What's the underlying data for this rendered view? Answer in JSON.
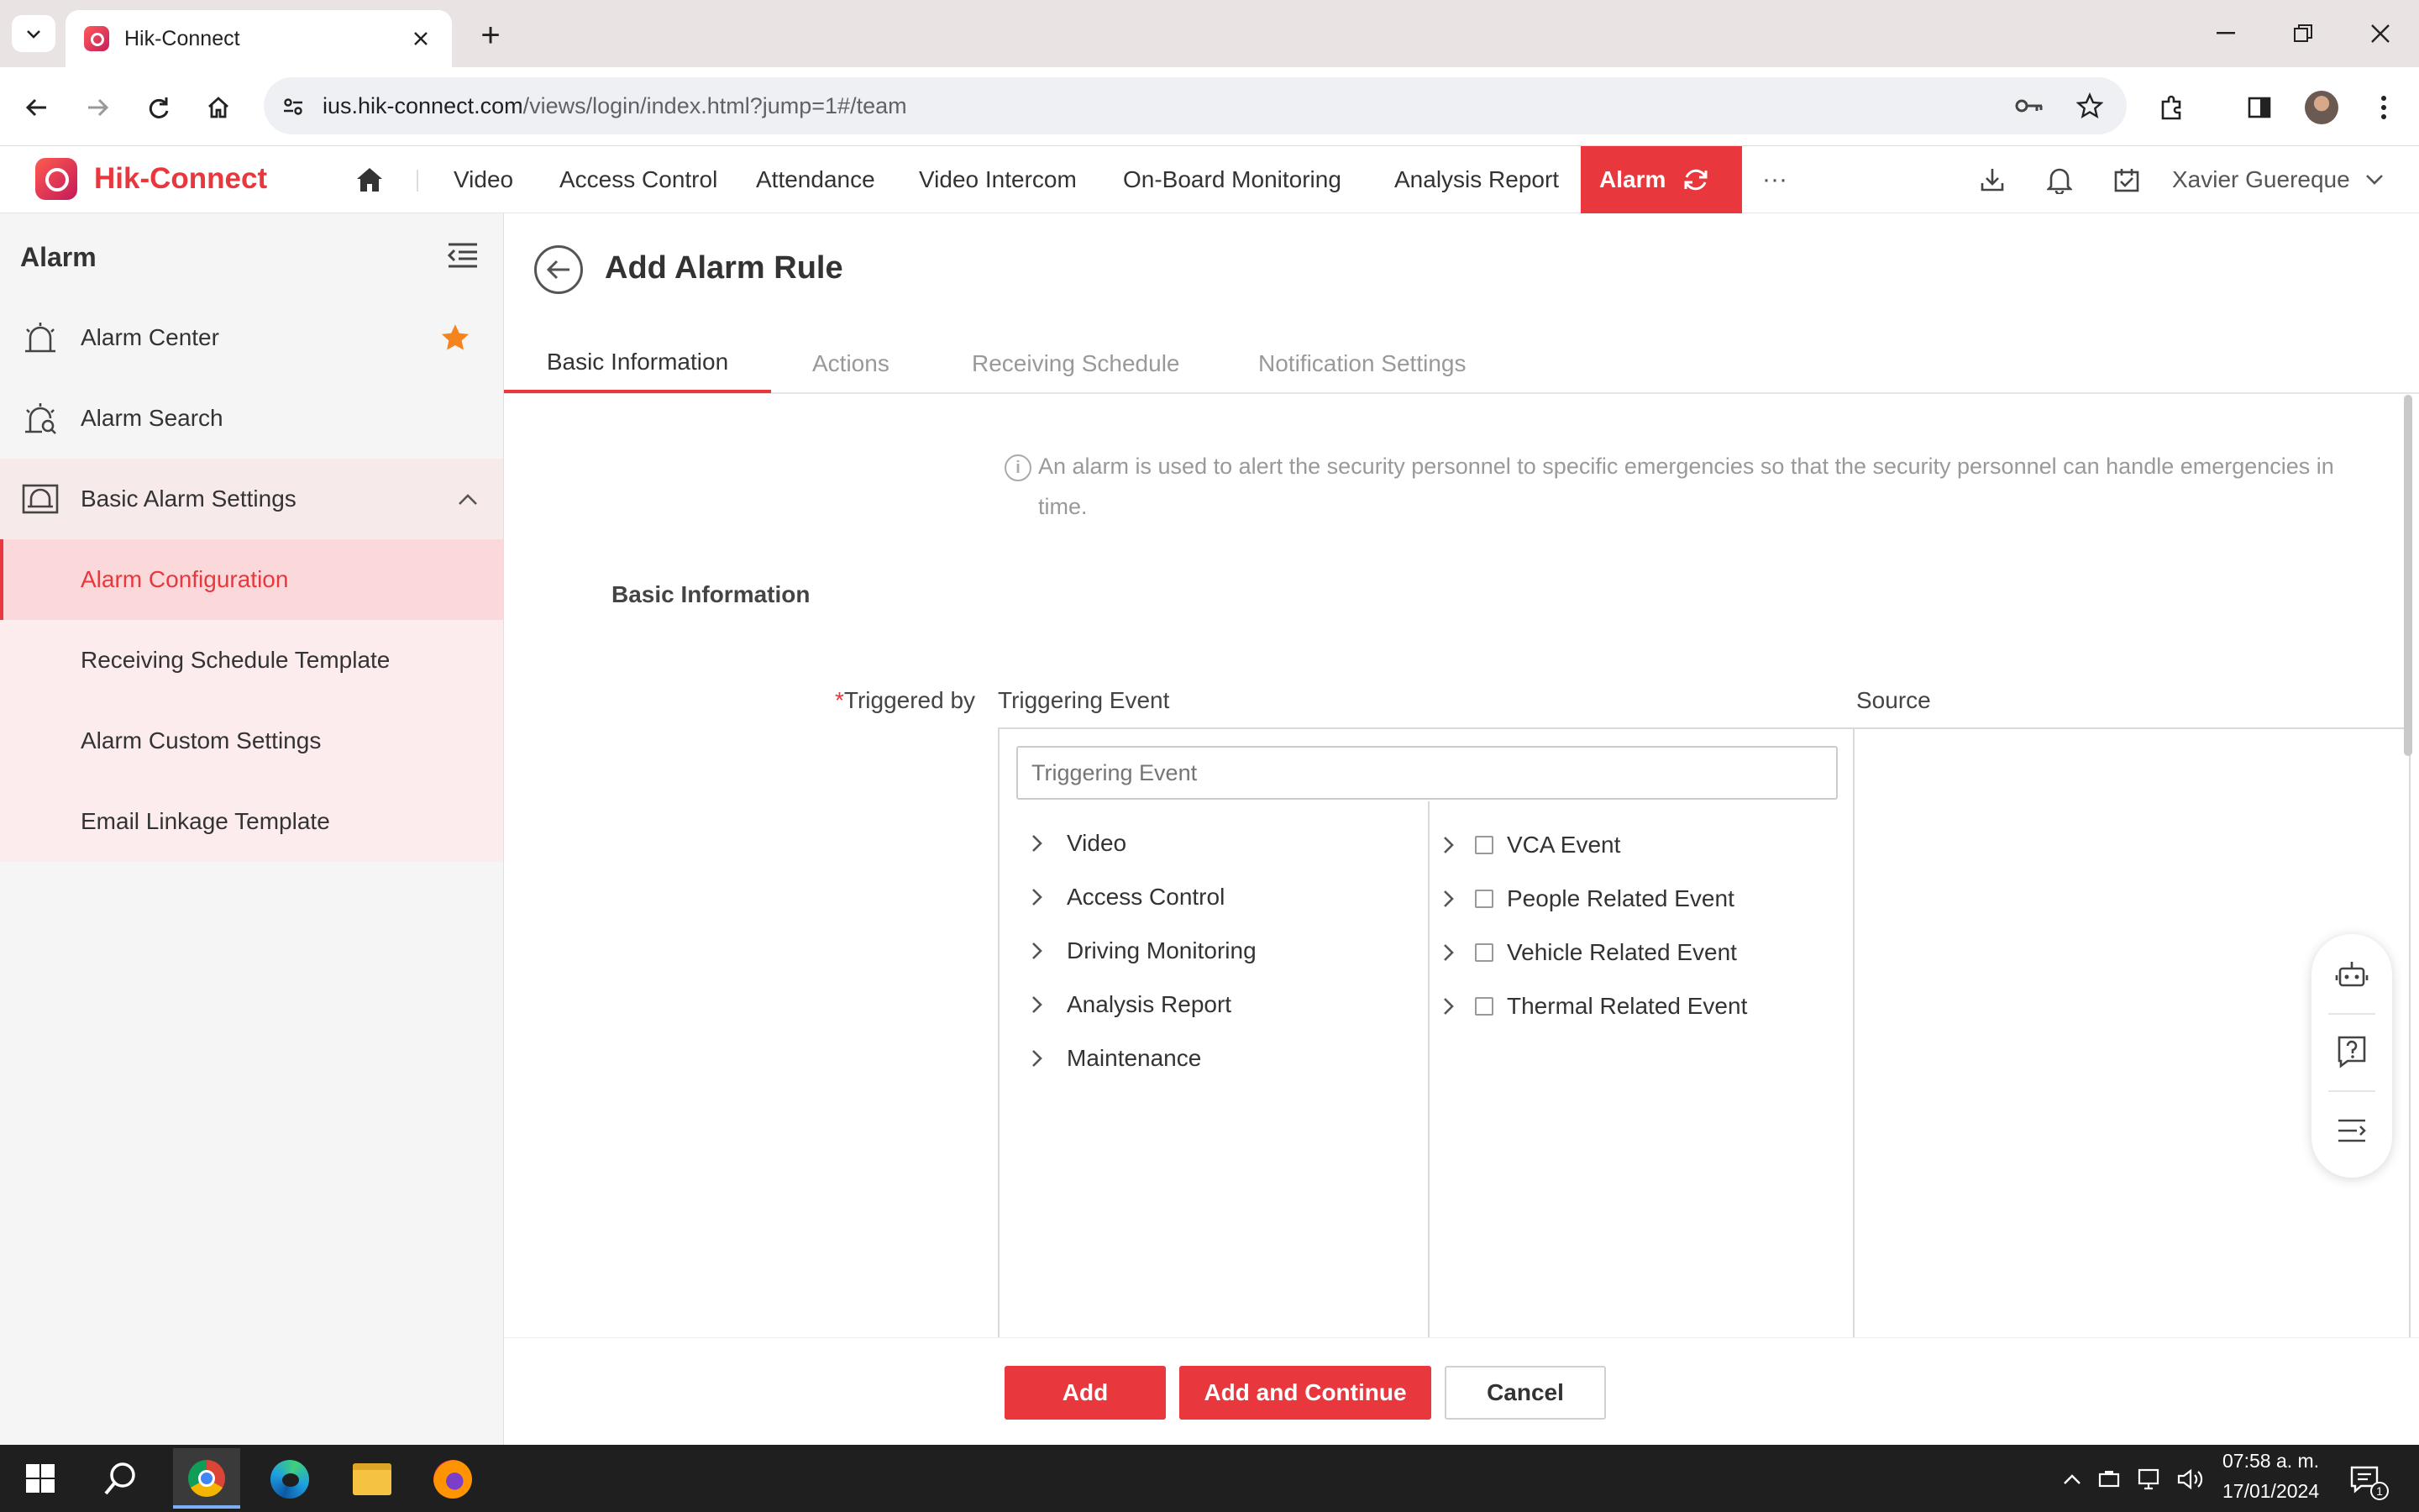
{
  "browser": {
    "tab_title": "Hik-Connect",
    "new_tab_glyph": "+",
    "url_host": "ius.hik-connect.com",
    "url_path": "/views/login/index.html?jump=1#/team"
  },
  "app": {
    "brand": "Hik-Connect",
    "nav": [
      "Video",
      "Access Control",
      "Attendance",
      "Video Intercom",
      "On-Board Monitoring",
      "Analysis Report",
      "Alarm"
    ],
    "more": "···",
    "user": "Xavier Guereque",
    "accent": "#e8383d"
  },
  "sidebar": {
    "title": "Alarm",
    "items": [
      {
        "label": "Alarm Center",
        "icon": "alarm-bell-icon"
      },
      {
        "label": "Alarm Search",
        "icon": "alarm-search-icon"
      },
      {
        "label": "Basic Alarm Settings",
        "icon": "alarm-settings-icon"
      }
    ],
    "subitems": [
      "Alarm Configuration",
      "Receiving Schedule Template",
      "Alarm Custom Settings",
      "Email Linkage Template"
    ]
  },
  "page": {
    "title": "Add Alarm Rule",
    "tabs": [
      "Basic Information",
      "Actions",
      "Receiving Schedule",
      "Notification Settings"
    ],
    "info_line1": "An alarm is used to alert the security personnel to specific emergencies so that the security personnel can handle emergencies in",
    "info_line2": "time.",
    "section_title": "Basic Information",
    "required_mark": "*",
    "triggered_by_label": "Triggered by",
    "col_event": "Triggering Event",
    "col_source": "Source",
    "search_placeholder": "Triggering Event",
    "categories": [
      "Video",
      "Access Control",
      "Driving Monitoring",
      "Analysis Report",
      "Maintenance"
    ],
    "events": [
      "VCA Event",
      "People Related Event",
      "Vehicle Related Event",
      "Thermal Related Event"
    ],
    "buttons": {
      "add": "Add",
      "add_continue": "Add and Continue",
      "cancel": "Cancel"
    }
  },
  "taskbar": {
    "time": "07:58 a. m.",
    "date": "17/01/2024",
    "notifications": "1"
  }
}
